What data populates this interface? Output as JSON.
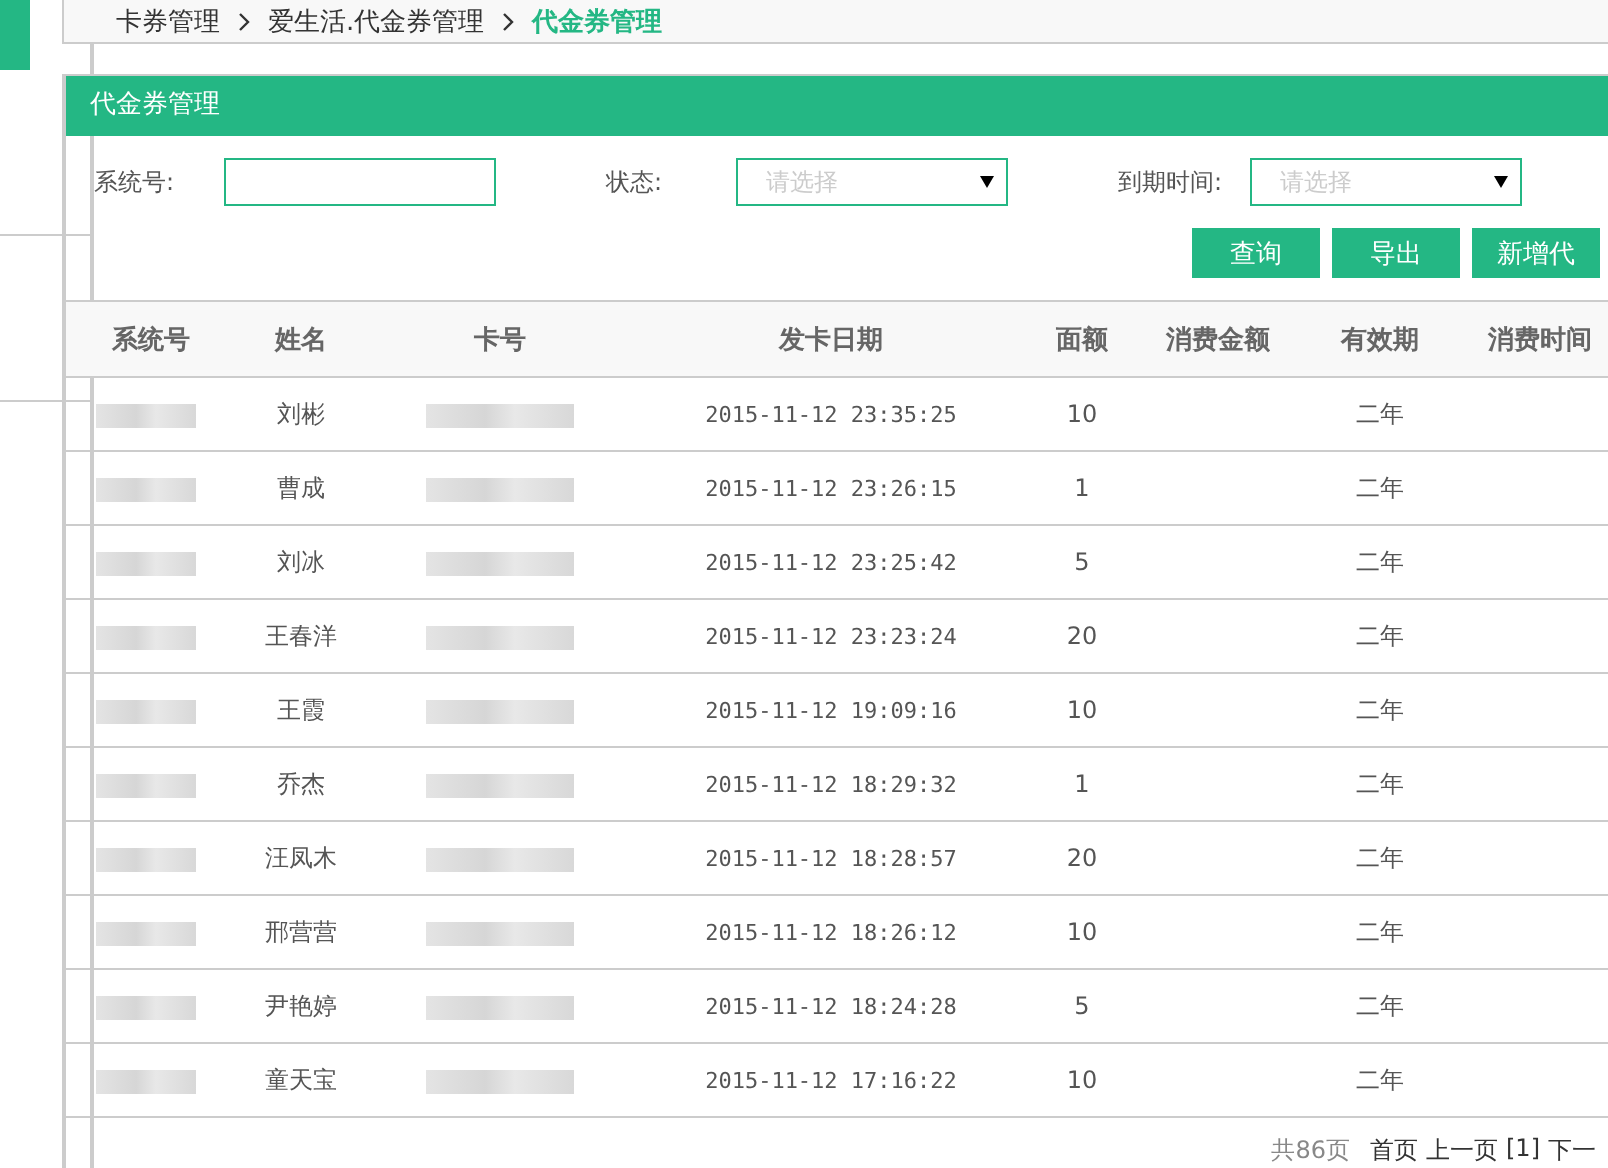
{
  "breadcrumb": [
    {
      "label": "卡券管理",
      "current": false
    },
    {
      "label": "爱生活.代金券管理",
      "current": false
    },
    {
      "label": "代金券管理",
      "current": true
    }
  ],
  "panel": {
    "title": "代金券管理",
    "filters": [
      {
        "kind": "text",
        "label": "系统号:"
      },
      {
        "kind": "select",
        "label": "状态:",
        "placeholder": "请选择"
      },
      {
        "kind": "select",
        "label": "到期时间:",
        "placeholder": "请选择"
      }
    ],
    "buttons": [
      "查询",
      "导出",
      "新增代"
    ]
  },
  "table": {
    "columns": [
      "系统号",
      "姓名",
      "卡号",
      "发卡日期",
      "面额",
      "消费金额",
      "有效期",
      "消费时间"
    ],
    "rows": [
      {
        "redacted": true,
        "name": "刘彬",
        "date": "2015-11-12 23:35:25",
        "amount": "10",
        "validity": "二年"
      },
      {
        "redacted": true,
        "name": "曹成",
        "date": "2015-11-12 23:26:15",
        "amount": "1",
        "validity": "二年"
      },
      {
        "redacted": true,
        "name": "刘冰",
        "date": "2015-11-12 23:25:42",
        "amount": "5",
        "validity": "二年"
      },
      {
        "redacted": true,
        "name": "王春洋",
        "date": "2015-11-12 23:23:24",
        "amount": "20",
        "validity": "二年"
      },
      {
        "redacted": true,
        "name": "王霞",
        "date": "2015-11-12 19:09:16",
        "amount": "10",
        "validity": "二年"
      },
      {
        "redacted": true,
        "name": "乔杰",
        "date": "2015-11-12 18:29:32",
        "amount": "1",
        "validity": "二年"
      },
      {
        "redacted": true,
        "name": "汪凤木",
        "date": "2015-11-12 18:28:57",
        "amount": "20",
        "validity": "二年"
      },
      {
        "redacted": true,
        "name": "邢营营",
        "date": "2015-11-12 18:26:12",
        "amount": "10",
        "validity": "二年"
      },
      {
        "redacted": true,
        "name": "尹艳婷",
        "date": "2015-11-12 18:24:28",
        "amount": "5",
        "validity": "二年"
      },
      {
        "redacted": true,
        "name": "童天宝",
        "date": "2015-11-12 17:16:22",
        "amount": "10",
        "validity": "二年"
      }
    ]
  },
  "pagination": {
    "total": "共86页",
    "links": [
      "首页",
      "上一页",
      "[1]",
      "下一"
    ]
  }
}
